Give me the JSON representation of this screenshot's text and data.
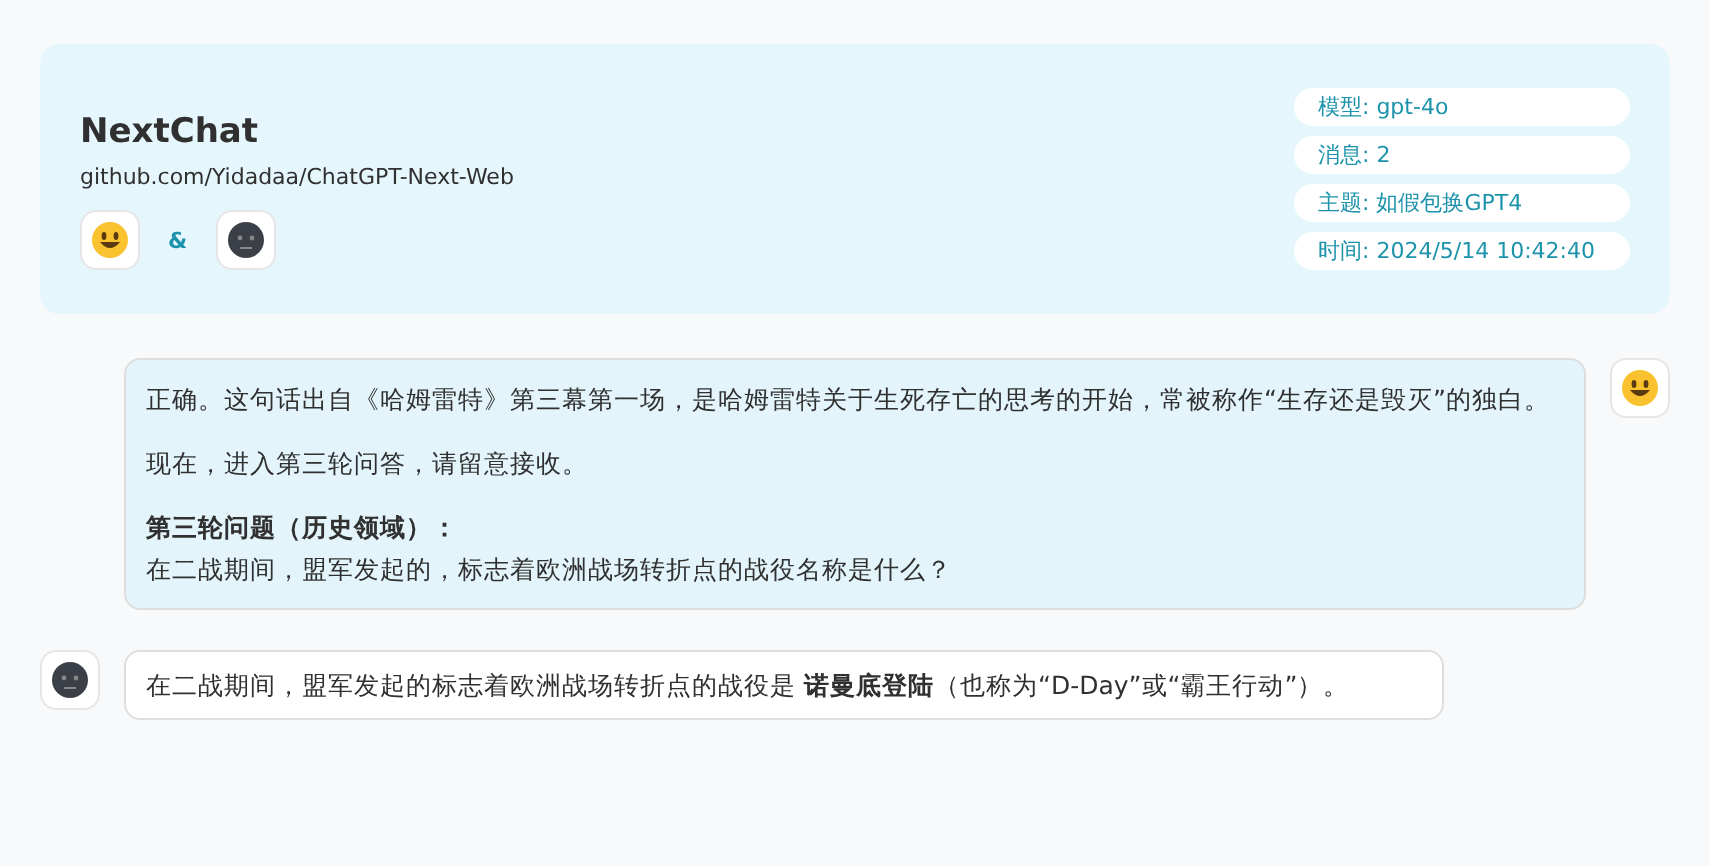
{
  "header": {
    "title": "NextChat",
    "subtitle": "github.com/Yidadaa/ChatGPT-Next-Web",
    "avatars": [
      {
        "kind": "smiley"
      },
      {
        "kind": "dark"
      }
    ],
    "connector": "&",
    "info": [
      "模型: gpt-4o",
      "消息: 2",
      "主题: 如假包换GPT4",
      "时间: 2024/5/14 10:42:40"
    ]
  },
  "messages": [
    {
      "kind": "user",
      "avatar": {
        "kind": "smiley"
      },
      "blocks": [
        {
          "kind": "text",
          "text": "正确。这句话出自《哈姆雷特》第三幕第一场，是哈姆雷特关于生死存亡的思考的开始，常被称作“生存还是毁灭”的独白。"
        },
        {
          "kind": "text",
          "text": "现在，进入第三轮问答，请留意接收。"
        },
        {
          "kind": "heading",
          "text": "第三轮问题（历史领域）："
        },
        {
          "kind": "text",
          "text": "在二战期间，盟军发起的，标志着欧洲战场转折点的战役名称是什么？"
        }
      ]
    },
    {
      "kind": "bot",
      "avatar": {
        "kind": "dark"
      },
      "blocks": [
        {
          "kind": "text",
          "text": "在二战期间，盟军发起的标志着欧洲战场转折点的战役是 **诺曼底登陆**（也称为“D-Day”或“霸王行动”）。"
        }
      ]
    }
  ]
}
